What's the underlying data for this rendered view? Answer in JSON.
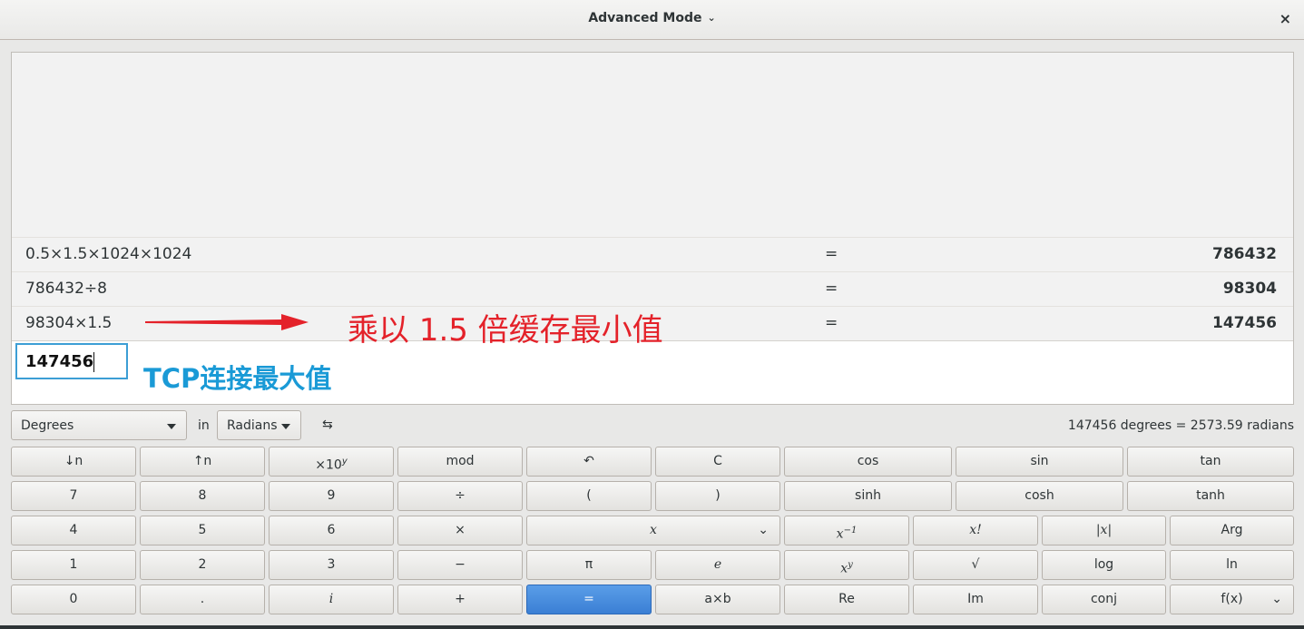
{
  "window": {
    "title": "Advanced Mode",
    "close_symbol": "×"
  },
  "history": [
    {
      "expression": "0.5×1.5×1024×1024",
      "equals": "=",
      "result": "786432"
    },
    {
      "expression": "786432÷8",
      "equals": "=",
      "result": "98304"
    },
    {
      "expression": "98304×1.5",
      "equals": "=",
      "result": "147456"
    }
  ],
  "entry": {
    "value": "147456"
  },
  "annotations": {
    "red": "乘以 1.5 倍缓存最小值",
    "blue": "TCP连接最大值",
    "colors": {
      "red": "#e4222a",
      "blue": "#1a9ad6"
    }
  },
  "conversion": {
    "from_unit": "Degrees",
    "in_label": "in",
    "to_unit": "Radians",
    "swap_symbol": "⇆",
    "result": "147456 degrees  =  2573.59 radians"
  },
  "buttons": {
    "row1": [
      "↓n",
      "↑n",
      "×10",
      "mod",
      "↶",
      "C",
      "cos",
      "sin",
      "tan"
    ],
    "row2": [
      "7",
      "8",
      "9",
      "÷",
      "(",
      ")",
      "sinh",
      "cosh",
      "tanh"
    ],
    "row3": [
      "4",
      "5",
      "6",
      "×",
      "x",
      "x",
      "x!",
      "|x|",
      "Arg"
    ],
    "row4": [
      "1",
      "2",
      "3",
      "−",
      "π",
      "e",
      "x",
      "√",
      "log",
      "ln"
    ],
    "row5": [
      "0",
      ".",
      "i",
      "+",
      "=",
      "a×b",
      "Re",
      "Im",
      "conj",
      "f(x)"
    ],
    "superscripts": {
      "exp10": "y",
      "inverse": "−1",
      "power": "y"
    },
    "dropdown_symbol": "⌄",
    "accent": "#3b7fd4"
  }
}
